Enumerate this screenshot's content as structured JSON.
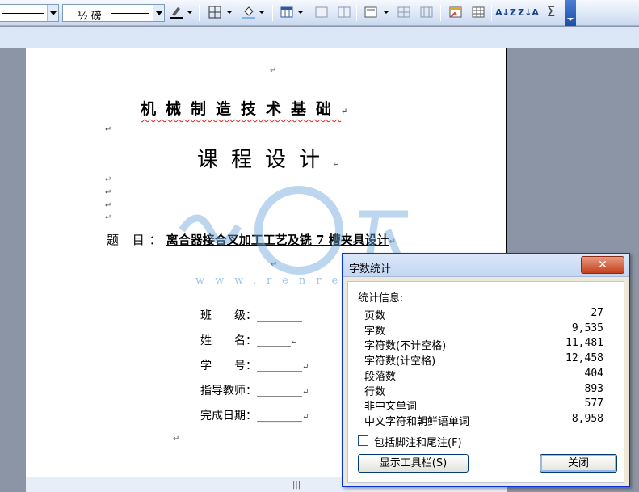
{
  "toolbar": {
    "line_weight": "½ 磅",
    "icons": [
      "borders-icon",
      "shading-icon",
      "insert-table-icon",
      "merge-cells-icon",
      "split-cells-icon",
      "align-icon",
      "distribute-rows-icon",
      "distribute-columns-icon",
      "autoformat-icon",
      "table-grid-icon",
      "sort-ascending-icon",
      "sort-descending-icon",
      "autosum-icon"
    ],
    "sort_asc": "A↓Z",
    "sort_desc": "Z↓A",
    "sum": "Σ"
  },
  "document": {
    "title1": "机械制造技术基础",
    "title2": "课程设计",
    "topic_label": "题 目：",
    "topic_value": "离合器接合叉加工工艺及铣 7 槽夹具设计",
    "fields": [
      {
        "label": "班　　级：",
        "blank": "________"
      },
      {
        "label": "姓　　名：",
        "blank": "______"
      },
      {
        "label": "学　　号：",
        "blank": "________"
      },
      {
        "label": "指导教师：",
        "blank": "________"
      },
      {
        "label": "完成日期：",
        "blank": "________"
      }
    ],
    "paragraph_mark": "↵",
    "watermark_url": "www.renrendoc.com"
  },
  "dialog": {
    "title": "字数统计",
    "close_glyph": "✕",
    "stats_header": "统计信息:",
    "stats": [
      {
        "name": "页数",
        "value": "27"
      },
      {
        "name": "字数",
        "value": "9,535"
      },
      {
        "name": "字符数(不计空格)",
        "value": "11,481"
      },
      {
        "name": "字符数(计空格)",
        "value": "12,458"
      },
      {
        "name": "段落数",
        "value": "404"
      },
      {
        "name": "行数",
        "value": "893"
      },
      {
        "name": "非中文单词",
        "value": "577"
      },
      {
        "name": "中文字符和朝鲜语单词",
        "value": "8,958"
      }
    ],
    "checkbox_label": "包括脚注和尾注(F)",
    "show_toolbar_button": "显示工具栏(S)",
    "close_button": "关闭"
  },
  "colors": {
    "dialog_border": "#0831d9",
    "close_red": "#c6401c",
    "watermark_blue": "#9fc4e6"
  }
}
